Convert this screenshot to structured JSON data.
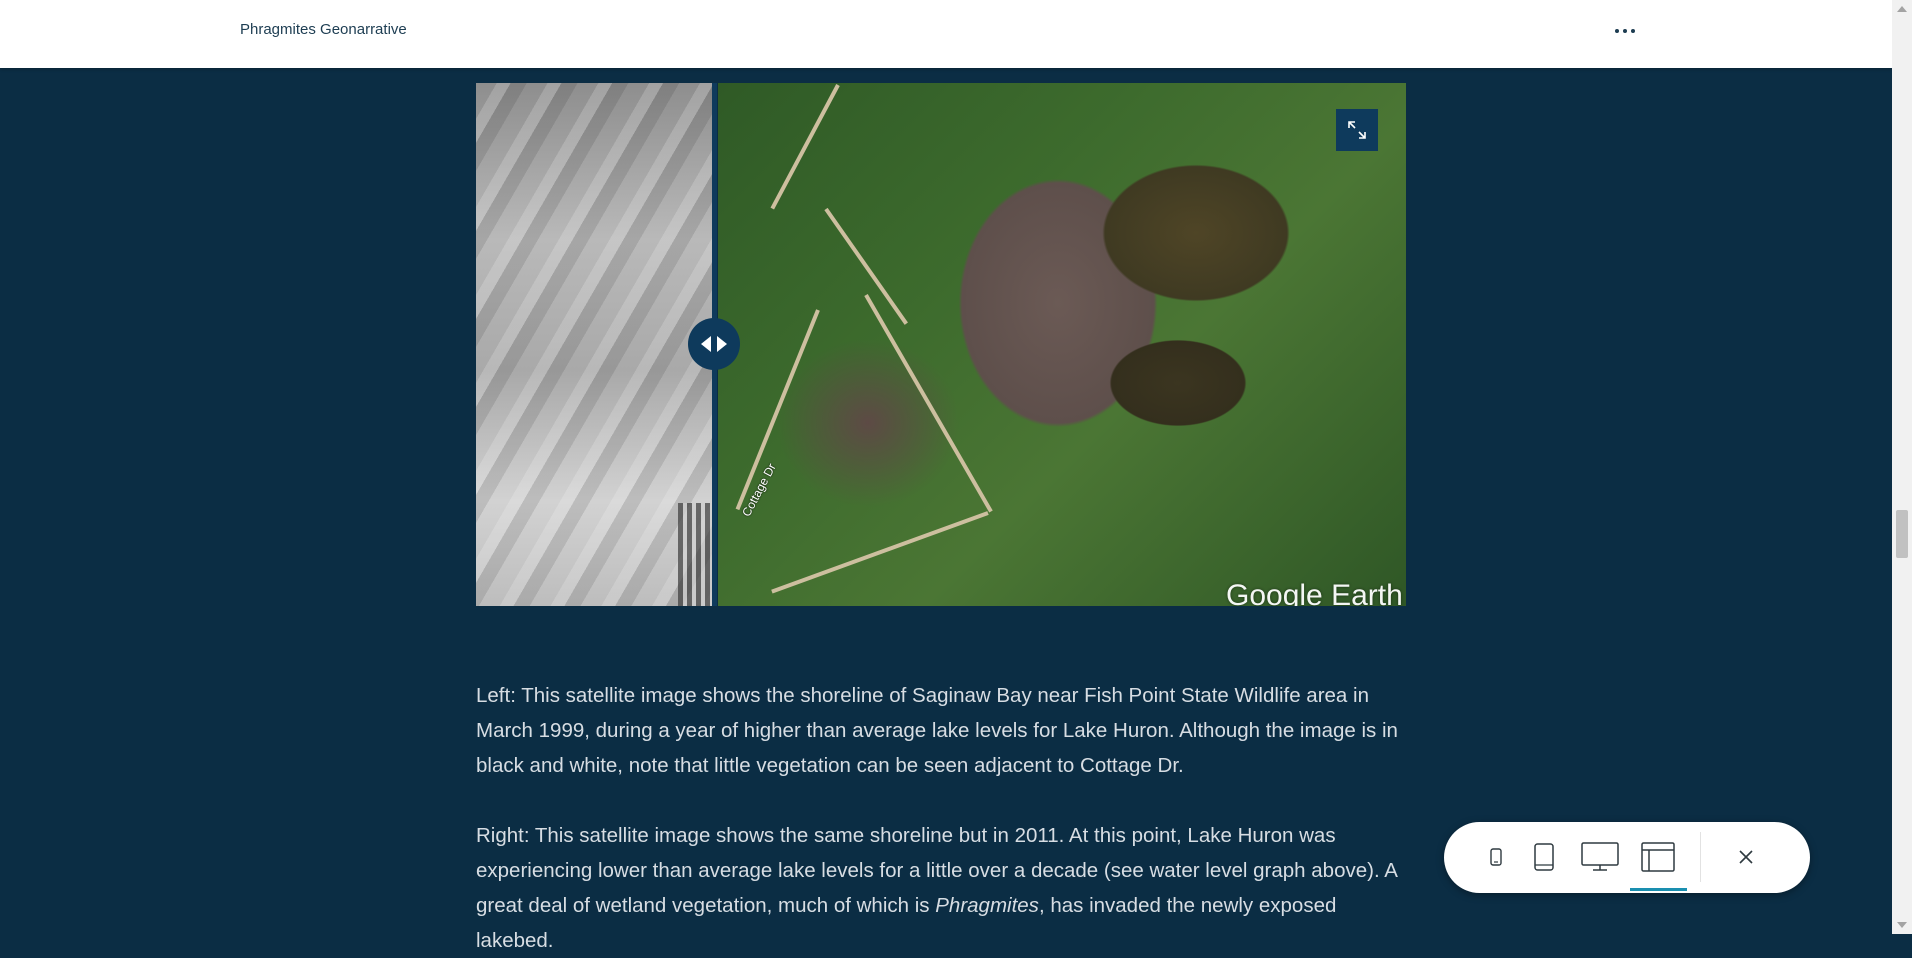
{
  "header": {
    "site_title": "Phragmites Geonarrative",
    "more_icon": "more-horizontal-icon"
  },
  "swipe": {
    "left_layer": "March 1999 black and white satellite image",
    "right_layer": "2011 satellite image",
    "road_label": "Cottage Dr",
    "watermark": "Google Earth",
    "handle_icon": "swipe-handle-icon",
    "expand_icon": "expand-icon"
  },
  "captions": {
    "left": "Left: This satellite image shows the shoreline of Saginaw Bay near Fish Point State Wildlife area in March 1999, during a year of higher than average lake levels for Lake Huron. Although the image is in black and white, note that little vegetation can be seen adjacent to Cottage Dr.",
    "right_part1": "Right: This satellite image shows the same shoreline but in 2011. At this point, Lake Huron was experiencing lower than average lake levels for a little over a decade (see water level graph above). A great deal of wetland vegetation, much of which is ",
    "right_italic": "Phragmites",
    "right_part2": ", has invaded the newly exposed lakebed."
  },
  "preview_toolbar": {
    "buttons": [
      {
        "name": "phone-preview",
        "icon": "phone-icon"
      },
      {
        "name": "tablet-preview",
        "icon": "tablet-icon"
      },
      {
        "name": "desktop-preview",
        "icon": "monitor-icon"
      },
      {
        "name": "browser-preview",
        "icon": "browser-window-icon",
        "active": true
      }
    ],
    "close_icon": "close-icon"
  },
  "colors": {
    "page_background": "#0b2d44",
    "accent": "#1a8fb0",
    "swipe_handle": "#0e3a5c"
  }
}
